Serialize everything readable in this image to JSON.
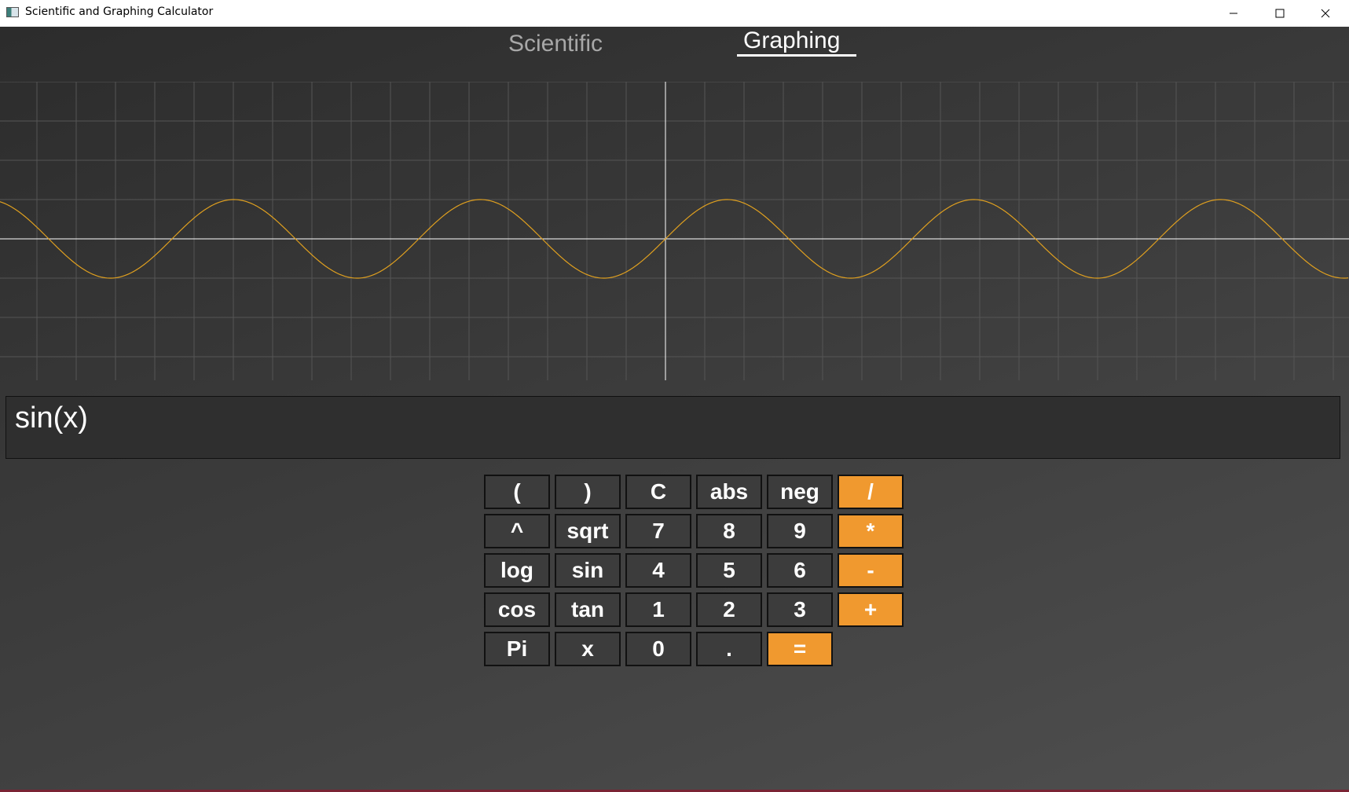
{
  "window": {
    "title": "Scientific and Graphing Calculator",
    "icon": "app-icon",
    "controls": [
      "minimize-icon",
      "maximize-icon",
      "close-icon"
    ]
  },
  "tabs": [
    {
      "label": "Scientific",
      "active": false
    },
    {
      "label": "Graphing",
      "active": true
    }
  ],
  "graph": {
    "function": "sin(x)",
    "curve_color": "#e0a01f",
    "axis_color": "#ffffff",
    "grid_color": "#555555"
  },
  "expression": "sin(x)",
  "keypad": [
    [
      "(",
      ")",
      "C",
      "abs",
      "neg",
      "/"
    ],
    [
      "^",
      "sqrt",
      "7",
      "8",
      "9",
      "*"
    ],
    [
      "log",
      "sin",
      "4",
      "5",
      "6",
      "-"
    ],
    [
      "cos",
      "tan",
      "1",
      "2",
      "3",
      "+"
    ],
    [
      "Pi",
      "x",
      "0",
      ".",
      "="
    ]
  ],
  "colors": {
    "operator": "#f0992f",
    "key": "#3c3c3c"
  }
}
